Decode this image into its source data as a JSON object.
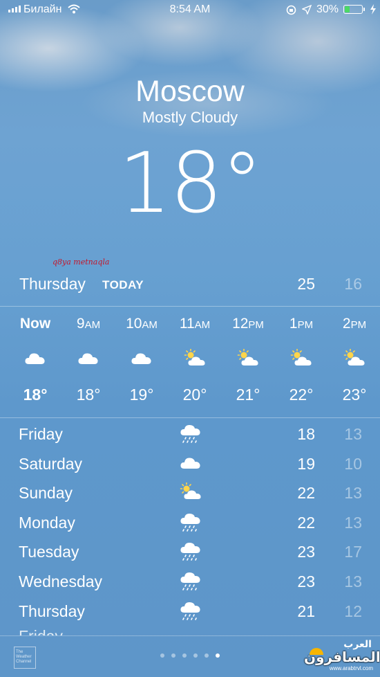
{
  "status_bar": {
    "carrier": "Билайн",
    "time": "8:54 AM",
    "battery_percent": "30%",
    "battery_level": 0.3,
    "battery_color": "#4cd964",
    "icons": [
      "signal-icon",
      "wifi-icon",
      "rotation-lock-icon",
      "location-arrow-icon",
      "charging-icon"
    ]
  },
  "location": {
    "city": "Moscow",
    "condition": "Mostly Cloudy",
    "temperature": "18°"
  },
  "watermark": "q8ya metnaqla",
  "today": {
    "day": "Thursday",
    "tag": "TODAY",
    "high": "25",
    "low": "16"
  },
  "hourly": [
    {
      "label": "Now",
      "suffix": "",
      "icon": "cloud-icon",
      "temp": "18°"
    },
    {
      "label": "9",
      "suffix": "AM",
      "icon": "cloud-icon",
      "temp": "18°"
    },
    {
      "label": "10",
      "suffix": "AM",
      "icon": "cloud-icon",
      "temp": "19°"
    },
    {
      "label": "11",
      "suffix": "AM",
      "icon": "partly-cloudy-icon",
      "temp": "20°"
    },
    {
      "label": "12",
      "suffix": "PM",
      "icon": "partly-cloudy-icon",
      "temp": "21°"
    },
    {
      "label": "1",
      "suffix": "PM",
      "icon": "partly-cloudy-icon",
      "temp": "22°"
    },
    {
      "label": "2",
      "suffix": "PM",
      "icon": "partly-cloudy-icon",
      "temp": "23°"
    }
  ],
  "daily": [
    {
      "day": "Friday",
      "icon": "rain-cloud-icon",
      "high": "18",
      "low": "13"
    },
    {
      "day": "Saturday",
      "icon": "cloud-icon",
      "high": "19",
      "low": "10"
    },
    {
      "day": "Sunday",
      "icon": "partly-cloudy-icon",
      "high": "22",
      "low": "13"
    },
    {
      "day": "Monday",
      "icon": "rain-cloud-icon",
      "high": "22",
      "low": "13"
    },
    {
      "day": "Tuesday",
      "icon": "rain-cloud-icon",
      "high": "23",
      "low": "17"
    },
    {
      "day": "Wednesday",
      "icon": "rain-cloud-icon",
      "high": "23",
      "low": "13"
    },
    {
      "day": "Thursday",
      "icon": "rain-cloud-icon",
      "high": "21",
      "low": "12"
    }
  ],
  "footer": {
    "weather_channel": "The Weather Channel",
    "pages": 6,
    "active_page": 6,
    "brand_top": "العرب",
    "brand_main": "المسافرون",
    "brand_url": "www.arabtrvl.com"
  }
}
